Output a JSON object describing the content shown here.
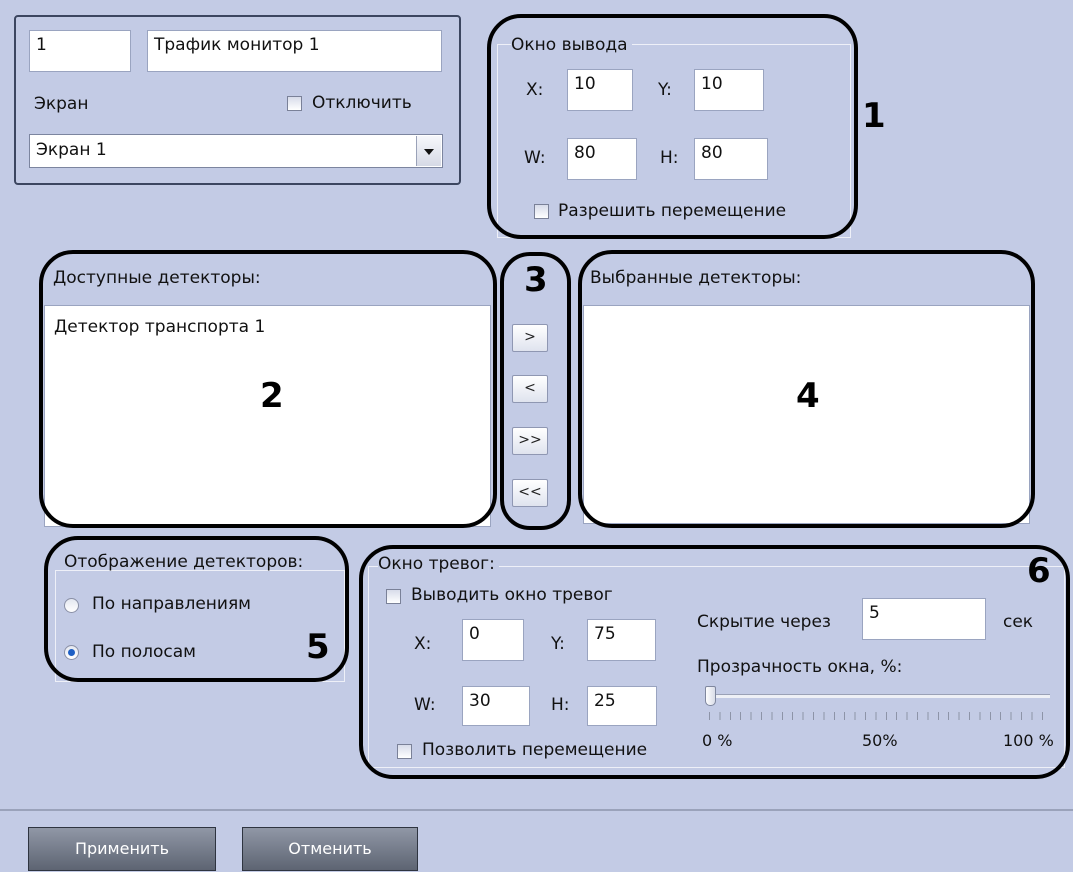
{
  "header": {
    "id_value": "1",
    "name_value": "Трафик монитор 1",
    "screen_label": "Экран",
    "disable_label": "Отключить",
    "screen_select_value": "Экран 1"
  },
  "output_window": {
    "title": "Окно вывода",
    "x_label": "X:",
    "x_value": "10",
    "y_label": "Y:",
    "y_value": "10",
    "w_label": "W:",
    "w_value": "80",
    "h_label": "H:",
    "h_value": "80",
    "allow_move_label": "Разрешить перемещение"
  },
  "available": {
    "title": "Доступные детекторы:",
    "items": [
      "Детектор транспорта 1"
    ]
  },
  "selected": {
    "title": "Выбранные детекторы:",
    "items": []
  },
  "move_buttons": [
    ">",
    "<",
    ">>",
    "<<"
  ],
  "display": {
    "title": "Отображение детекторов:",
    "options": [
      {
        "label": "По направлениям",
        "checked": false
      },
      {
        "label": "По полосам",
        "checked": true
      }
    ]
  },
  "alarm_window": {
    "title": "Окно тревог:",
    "show_label": "Выводить окно тревог",
    "x_label": "X:",
    "x_value": "0",
    "y_label": "Y:",
    "y_value": "75",
    "w_label": "W:",
    "w_value": "30",
    "h_label": "H:",
    "h_value": "25",
    "allow_move_label": "Позволить перемещение",
    "hide_after_label": "Скрытие через",
    "hide_after_value": "5",
    "seconds_label": "сек",
    "transparency_label": "Прозрачность окна, %:",
    "transparency_value": 0,
    "tick_0": "0 %",
    "tick_50": "50%",
    "tick_100": "100 %"
  },
  "callouts": [
    "1",
    "2",
    "3",
    "4",
    "5",
    "6"
  ],
  "footer": {
    "apply_label": "Применить",
    "cancel_label": "Отменить"
  }
}
